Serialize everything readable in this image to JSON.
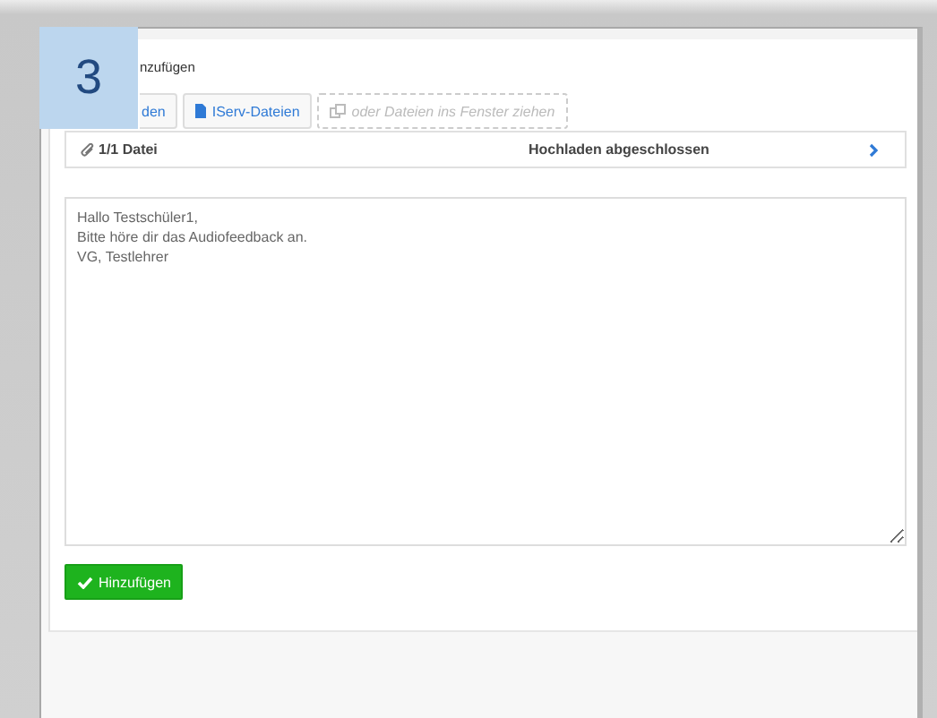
{
  "step_badge": "3",
  "heading": "nzufügen",
  "buttons": [
    {
      "kind": "upload",
      "label": "den"
    },
    {
      "kind": "iserv",
      "label": "IServ-Dateien"
    },
    {
      "kind": "drop",
      "label": "oder Dateien ins Fenster ziehen"
    }
  ],
  "file_bar": {
    "count": "1/1 Datei",
    "status": "Hochladen abgeschlossen"
  },
  "message": {
    "value": "Hallo Testschüler1,\nBitte höre dir das Audiofeedback an.\nVG, Testlehrer"
  },
  "submit": {
    "label": "Hinzufügen"
  }
}
